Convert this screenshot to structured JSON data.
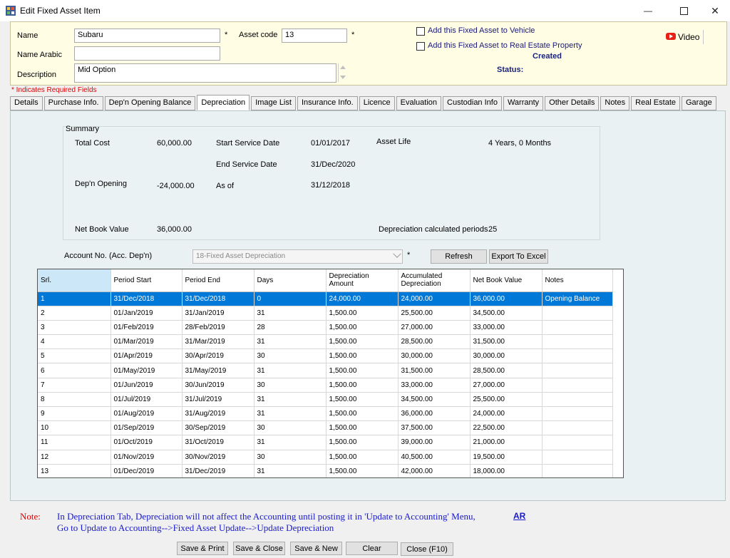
{
  "window": {
    "title": "Edit Fixed Asset Item",
    "minimize_glyph": "—",
    "close_glyph": "✕"
  },
  "header": {
    "name_label": "Name",
    "name_value": "Subaru",
    "asset_code_label": "Asset code",
    "asset_code_value": "13",
    "required_mark": "*",
    "name_arabic_label": "Name Arabic",
    "name_arabic_value": "",
    "description_label": "Description",
    "description_value": "Mid Option",
    "add_vehicle_label": "Add this Fixed Asset to Vehicle",
    "add_real_estate_label": "Add this Fixed Asset to Real Estate Property",
    "created_text": "Created",
    "status_label": "Status:",
    "video_label": "Video"
  },
  "required_note": "* Indicates Required Fields",
  "tabs": [
    {
      "label": "Details",
      "active": false
    },
    {
      "label": "Purchase Info.",
      "active": false
    },
    {
      "label": "Dep'n Opening Balance",
      "active": false
    },
    {
      "label": "Depreciation",
      "active": true
    },
    {
      "label": "Image List",
      "active": false
    },
    {
      "label": "Insurance Info.",
      "active": false
    },
    {
      "label": "Licence",
      "active": false
    },
    {
      "label": "Evaluation",
      "active": false
    },
    {
      "label": "Custodian Info",
      "active": false
    },
    {
      "label": "Warranty",
      "active": false
    },
    {
      "label": "Other Details",
      "active": false
    },
    {
      "label": "Notes",
      "active": false
    },
    {
      "label": "Real Estate",
      "active": false
    },
    {
      "label": "Garage",
      "active": false
    }
  ],
  "summary": {
    "title": "Summary",
    "total_cost_label": "Total Cost",
    "total_cost_value": "60,000.00",
    "start_service_label": "Start Service Date",
    "start_service_value": "01/01/2017",
    "asset_life_label": "Asset Life",
    "asset_life_value": "4 Years, 0 Months",
    "end_service_label": "End Service Date",
    "end_service_value": "31/Dec/2020",
    "depn_opening_label": "Dep'n Opening",
    "depn_opening_value": "-24,000.00",
    "as_of_label": "As of",
    "as_of_value": "31/12/2018",
    "net_book_label": "Net Book Value",
    "net_book_value": "36,000.00",
    "dep_periods_label": "Depreciation calculated periods",
    "dep_periods_value": "25"
  },
  "account": {
    "label": "Account No. (Acc. Dep'n)",
    "value": "18-Fixed Asset Depreciation",
    "required_mark": "*",
    "refresh_label": "Refresh",
    "export_label": "Export To Excel"
  },
  "grid": {
    "columns": [
      "Srl.",
      "Period Start",
      "Period End",
      "Days",
      "Depreciation Amount",
      "Accumulated Depreciation",
      "Net Book Value",
      "Notes"
    ],
    "rows": [
      [
        "1",
        "31/Dec/2018",
        "31/Dec/2018",
        "0",
        "24,000.00",
        "24,000.00",
        "36,000.00",
        "Opening Balance"
      ],
      [
        "2",
        "01/Jan/2019",
        "31/Jan/2019",
        "31",
        "1,500.00",
        "25,500.00",
        "34,500.00",
        ""
      ],
      [
        "3",
        "01/Feb/2019",
        "28/Feb/2019",
        "28",
        "1,500.00",
        "27,000.00",
        "33,000.00",
        ""
      ],
      [
        "4",
        "01/Mar/2019",
        "31/Mar/2019",
        "31",
        "1,500.00",
        "28,500.00",
        "31,500.00",
        ""
      ],
      [
        "5",
        "01/Apr/2019",
        "30/Apr/2019",
        "30",
        "1,500.00",
        "30,000.00",
        "30,000.00",
        ""
      ],
      [
        "6",
        "01/May/2019",
        "31/May/2019",
        "31",
        "1,500.00",
        "31,500.00",
        "28,500.00",
        ""
      ],
      [
        "7",
        "01/Jun/2019",
        "30/Jun/2019",
        "30",
        "1,500.00",
        "33,000.00",
        "27,000.00",
        ""
      ],
      [
        "8",
        "01/Jul/2019",
        "31/Jul/2019",
        "31",
        "1,500.00",
        "34,500.00",
        "25,500.00",
        ""
      ],
      [
        "9",
        "01/Aug/2019",
        "31/Aug/2019",
        "31",
        "1,500.00",
        "36,000.00",
        "24,000.00",
        ""
      ],
      [
        "10",
        "01/Sep/2019",
        "30/Sep/2019",
        "30",
        "1,500.00",
        "37,500.00",
        "22,500.00",
        ""
      ],
      [
        "11",
        "01/Oct/2019",
        "31/Oct/2019",
        "31",
        "1,500.00",
        "39,000.00",
        "21,000.00",
        ""
      ],
      [
        "12",
        "01/Nov/2019",
        "30/Nov/2019",
        "30",
        "1,500.00",
        "40,500.00",
        "19,500.00",
        ""
      ],
      [
        "13",
        "01/Dec/2019",
        "31/Dec/2019",
        "31",
        "1,500.00",
        "42,000.00",
        "18,000.00",
        ""
      ]
    ]
  },
  "note": {
    "label": "Note:",
    "line1": "In Depreciation Tab, Depreciation will not affect the Accounting until posting it in 'Update to Accounting' Menu,",
    "line2": "Go to Update to Accounting-->Fixed Asset Update-->Update Depreciation",
    "ar_link": "AR"
  },
  "footer": {
    "save_print": "Save & Print",
    "save_close": "Save & Close",
    "save_new": "Save & New",
    "clear": "Clear",
    "close": "Close (F10)"
  },
  "colors": {
    "header_bg": "#fffde4",
    "selection": "#0078d7",
    "required_red": "#e00000",
    "note_blue": "#1a1acd"
  }
}
